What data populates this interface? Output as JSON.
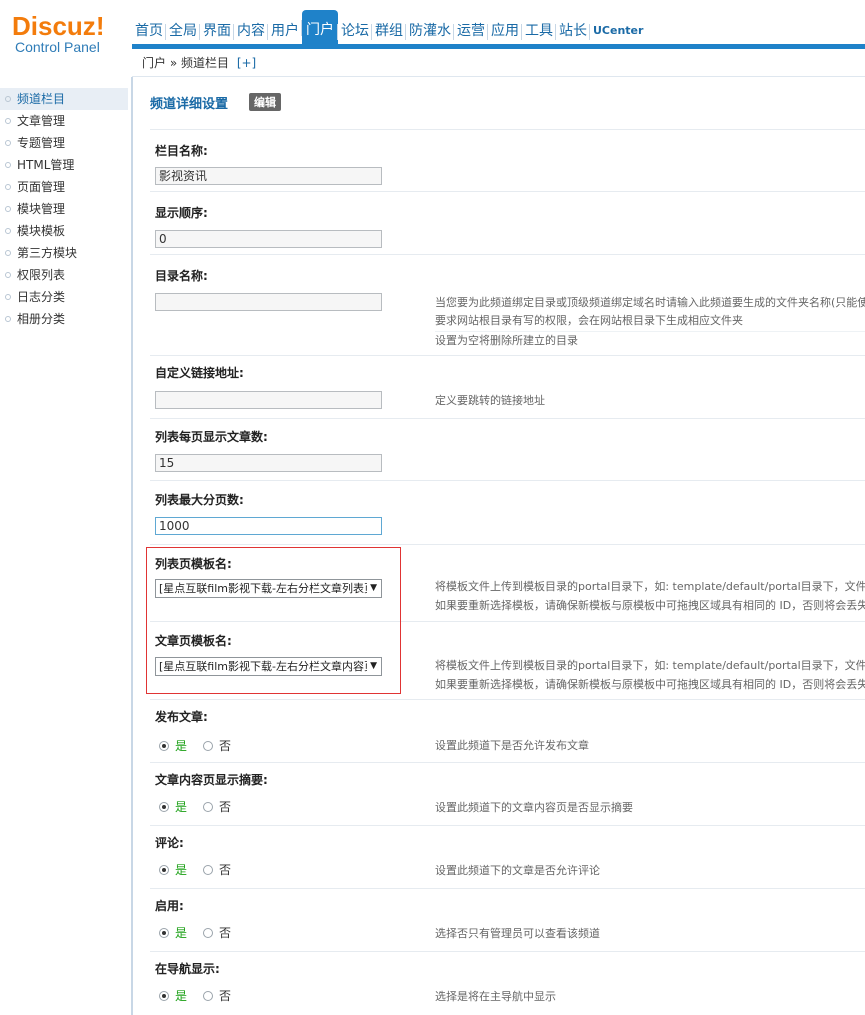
{
  "logo": {
    "brand": "Discuz",
    "bang": "!",
    "subtitle": "Control Panel"
  },
  "topnav": [
    "首页",
    "全局",
    "界面",
    "内容",
    "用户",
    "门户",
    "论坛",
    "群组",
    "防灌水",
    "运营",
    "应用",
    "工具",
    "站长",
    "UCenter"
  ],
  "breadcrumb": {
    "text": "门户 » 频道栏目",
    "add": "[+]"
  },
  "sidebar": [
    "频道栏目",
    "文章管理",
    "专题管理",
    "HTML管理",
    "页面管理",
    "模块管理",
    "模块模板",
    "第三方模块",
    "权限列表",
    "日志分类",
    "相册分类"
  ],
  "main": {
    "section_title": "频道详细设置",
    "edit_label": "编辑",
    "fields": {
      "column_name": {
        "label": "栏目名称:",
        "value": "影视资讯"
      },
      "display_order": {
        "label": "显示顺序:",
        "value": "0"
      },
      "dir_name": {
        "label": "目录名称:",
        "value": "",
        "hint1": "当您要为此频道绑定目录或顶级频道绑定域名时请输入此频道要生成的文件夹名称(只能使用",
        "hint2": "要求网站根目录有写的权限，会在网站根目录下生成相应文件夹",
        "hint3": "设置为空将删除所建立的目录"
      },
      "custom_url": {
        "label": "自定义链接地址:",
        "value": "",
        "hint": "定义要跳转的链接地址"
      },
      "per_page": {
        "label": "列表每页显示文章数:",
        "value": "15"
      },
      "max_pages": {
        "label": "列表最大分页数:",
        "value": "1000"
      },
      "list_tpl": {
        "label": "列表页模板名:",
        "value": "[星点互联film影视下载-左右分栏文章列表页",
        "hint1": "将模板文件上传到模板目录的portal目录下，如: template/default/portal目录下，文件",
        "hint2": "如果要重新选择模板，请确保新模板与原模板中可拖拽区域具有相同的 ID，否则将会丢失部"
      },
      "article_tpl": {
        "label": "文章页模板名:",
        "value": "[星点互联film影视下载-左右分栏文章内容页",
        "hint1": "将模板文件上传到模板目录的portal目录下，如: template/default/portal目录下，文件",
        "hint2": "如果要重新选择模板，请确保新模板与原模板中可拖拽区域具有相同的 ID，否则将会丢失部"
      },
      "publish": {
        "label": "发布文章:",
        "hint": "设置此频道下是否允许发布文章"
      },
      "summary": {
        "label": "文章内容页显示摘要:",
        "hint": "设置此频道下的文章内容页是否显示摘要"
      },
      "comment": {
        "label": "评论:",
        "hint": "设置此频道下的文章是否允许评论"
      },
      "enable": {
        "label": "启用:",
        "hint": "选择否只有管理员可以查看该频道"
      },
      "nav_show": {
        "label": "在导航显示:",
        "hint": "选择是将在主导航中显示"
      }
    },
    "yes": "是",
    "no": "否"
  },
  "colors": {
    "accent": "#1f82c9",
    "logo": "#f37c0c",
    "yes": "#1aa014",
    "highlight": "#e03434"
  }
}
